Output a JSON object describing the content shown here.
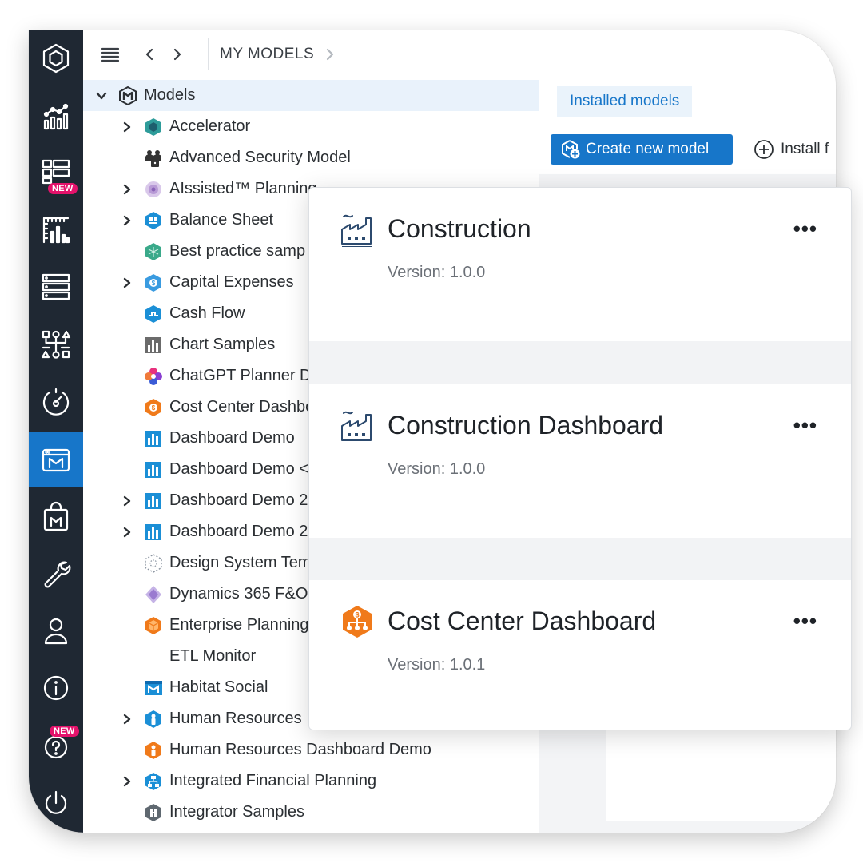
{
  "topbar": {
    "breadcrumb": "MY MODELS"
  },
  "rail": {
    "new_badge": "NEW",
    "help_new_badge": "NEW",
    "items": [
      {
        "icon": "hexagon-logo-icon"
      },
      {
        "icon": "analytics-icon"
      },
      {
        "icon": "dashboard-grid-icon"
      },
      {
        "icon": "report-chart-icon"
      },
      {
        "icon": "data-list-icon"
      },
      {
        "icon": "process-flow-icon"
      },
      {
        "icon": "speed-gauge-icon"
      },
      {
        "icon": "models-icon"
      },
      {
        "icon": "store-bag-icon"
      },
      {
        "icon": "wrench-icon"
      },
      {
        "icon": "user-icon"
      },
      {
        "icon": "info-icon"
      },
      {
        "icon": "help-icon"
      },
      {
        "icon": "power-icon"
      }
    ]
  },
  "tree": {
    "root": "Models",
    "items": [
      {
        "label": "Accelerator",
        "expandable": true,
        "icon": "teal-hex-icon"
      },
      {
        "label": "Advanced Security Model",
        "expandable": false,
        "icon": "security-people-icon"
      },
      {
        "label": "AIssisted™ Planning",
        "expandable": true,
        "icon": "ai-sphere-icon"
      },
      {
        "label": "Balance Sheet",
        "expandable": true,
        "icon": "blue-hex-icon"
      },
      {
        "label": "Best practice samp",
        "expandable": false,
        "icon": "green-hex-icon"
      },
      {
        "label": "Capital Expenses",
        "expandable": true,
        "icon": "blue-coin-hex-icon"
      },
      {
        "label": "Cash Flow",
        "expandable": false,
        "icon": "blue-flow-hex-icon"
      },
      {
        "label": "Chart Samples",
        "expandable": false,
        "icon": "gray-chart-icon"
      },
      {
        "label": "ChatGPT Planner D",
        "expandable": false,
        "icon": "chatgpt-flower-icon"
      },
      {
        "label": "Cost Center Dashbo",
        "expandable": false,
        "icon": "orange-dollar-hex-icon"
      },
      {
        "label": "Dashboard Demo",
        "expandable": false,
        "icon": "blue-bar-chart-icon"
      },
      {
        "label": "Dashboard Demo <",
        "expandable": false,
        "icon": "blue-bar-chart-icon"
      },
      {
        "label": "Dashboard Demo 2",
        "expandable": true,
        "icon": "blue-bar-chart-icon"
      },
      {
        "label": "Dashboard Demo 2",
        "expandable": true,
        "icon": "blue-bar-chart-icon"
      },
      {
        "label": "Design System Tem",
        "expandable": false,
        "icon": "dotted-hex-icon"
      },
      {
        "label": "Dynamics 365 F&O",
        "expandable": false,
        "icon": "purple-diamond-icon"
      },
      {
        "label": "Enterprise Planning",
        "expandable": false,
        "icon": "orange-cube-icon"
      },
      {
        "label": "ETL Monitor",
        "expandable": false,
        "icon": ""
      },
      {
        "label": "Habitat Social",
        "expandable": false,
        "icon": "habitat-window-icon"
      },
      {
        "label": "Human Resources",
        "expandable": true,
        "icon": "blue-person-hex-icon"
      },
      {
        "label": "Human Resources Dashboard Demo",
        "expandable": false,
        "icon": "orange-person-hex-icon"
      },
      {
        "label": "Integrated Financial Planning",
        "expandable": true,
        "icon": "blue-network-hex-icon"
      },
      {
        "label": "Integrator Samples",
        "expandable": false,
        "icon": "gray-hex-icon"
      }
    ]
  },
  "right": {
    "tab": "Installed models",
    "create_button": "Create new model",
    "install_button": "Install f"
  },
  "popup": {
    "cards": [
      {
        "title": "Construction",
        "version": "Version: 1.0.0",
        "more": "•••",
        "icon": "factory-icon"
      },
      {
        "title": "Construction Dashboard",
        "version": "Version: 1.0.0",
        "more": "•••",
        "icon": "factory-icon"
      },
      {
        "title": "Cost Center Dashboard",
        "version": "Version: 1.0.1",
        "more": "•••",
        "icon": "orange-dollar-hex-icon"
      }
    ]
  },
  "colors": {
    "rail_bg": "#1f2833",
    "accent": "#1776c9",
    "badge": "#e4126b",
    "selected_row": "#e9f2fb"
  }
}
